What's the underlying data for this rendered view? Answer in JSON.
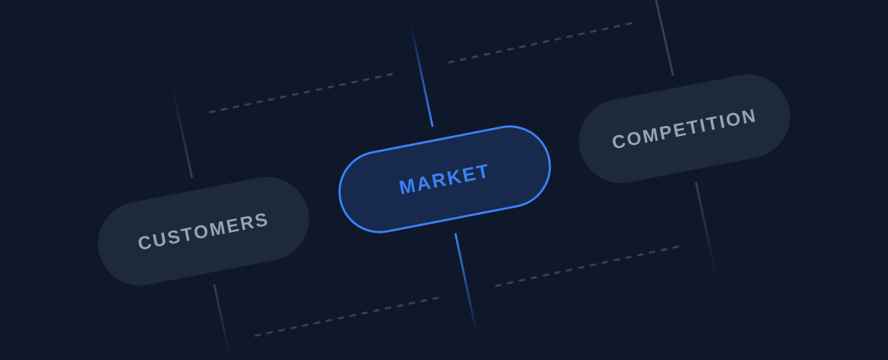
{
  "diagram": {
    "nodes": [
      {
        "id": "customers",
        "label": "CUSTOMERS",
        "state": "default"
      },
      {
        "id": "market",
        "label": "MARKET",
        "state": "active"
      },
      {
        "id": "competition",
        "label": "COMPETITION",
        "state": "default"
      }
    ]
  },
  "colors": {
    "background": "#0f172a",
    "pill_muted_fill": "#1e293b",
    "pill_muted_text": "#94a3b8",
    "pill_active_fill": "#172a4d",
    "accent": "#3b82f6",
    "line_muted": "#334155"
  }
}
